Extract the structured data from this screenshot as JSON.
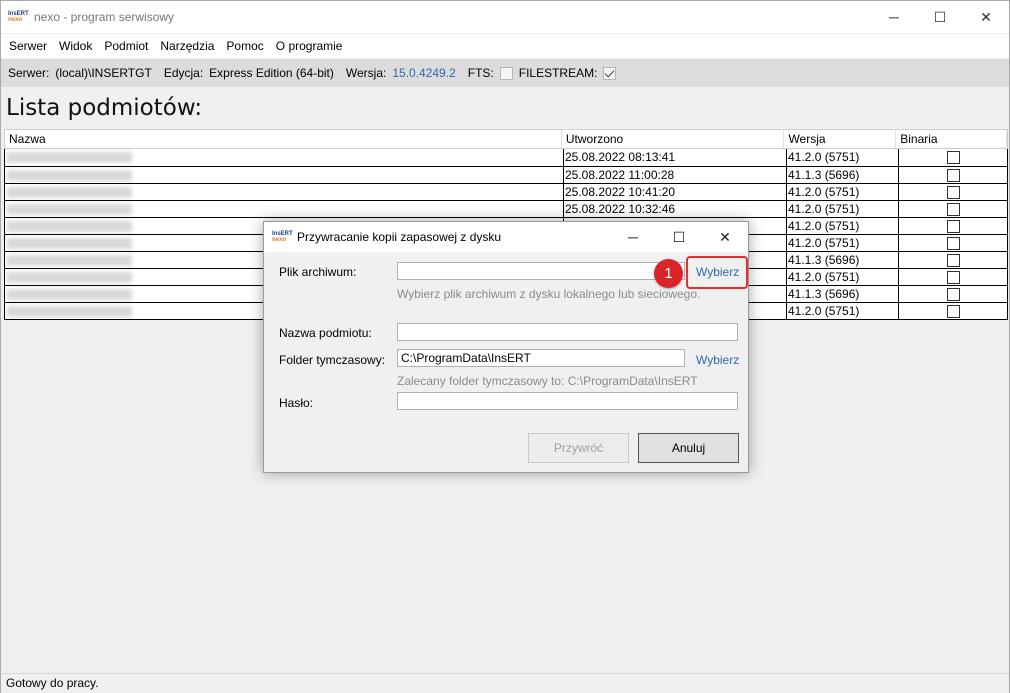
{
  "window": {
    "logo_top": "InsERT",
    "logo_bottom": "nexo",
    "title": "nexo - program serwisowy",
    "minimize": "─",
    "maximize": "☐",
    "close": "✕"
  },
  "menu": [
    "Serwer",
    "Widok",
    "Podmiot",
    "Narzędzia",
    "Pomoc",
    "O programie"
  ],
  "info": {
    "server_label": "Serwer:",
    "server_value": "(local)\\INSERTGT",
    "edition_label": "Edycja:",
    "edition_value": "Express Edition (64-bit)",
    "version_label": "Wersja:",
    "version_value": "15.0.4249.2",
    "fts_label": "FTS:",
    "filestream_label": "FILESTREAM:",
    "fts_checked": false,
    "filestream_checked": true,
    "version_color": "#2a6ab0"
  },
  "heading": "Lista podmiotów:",
  "table": {
    "columns": [
      "Nazwa",
      "Utworzono",
      "Wersja",
      "Binaria"
    ],
    "rows": [
      {
        "date": "25.08.2022 08:13:41",
        "version": "41.2.0 (5751)"
      },
      {
        "date": "25.08.2022 11:00:28",
        "version": "41.1.3 (5696)"
      },
      {
        "date": "25.08.2022 10:41:20",
        "version": "41.2.0 (5751)"
      },
      {
        "date": "25.08.2022 10:32:46",
        "version": "41.2.0 (5751)"
      },
      {
        "date": "",
        "version": "41.2.0 (5751)"
      },
      {
        "date": "",
        "version": "41.2.0 (5751)"
      },
      {
        "date": "",
        "version": "41.1.3 (5696)"
      },
      {
        "date": "",
        "version": "41.2.0 (5751)"
      },
      {
        "date": "",
        "version": "41.1.3 (5696)"
      },
      {
        "date": "",
        "version": "41.2.0 (5751)"
      }
    ]
  },
  "dialog": {
    "title": "Przywracanie kopii zapasowej z dysku",
    "archive_label": "Plik archiwum:",
    "archive_value": "",
    "archive_browse": "Wybierz",
    "archive_hint": "Wybierz plik archiwum z dysku lokalnego lub sieciowego.",
    "name_label": "Nazwa podmiotu:",
    "name_value": "",
    "temp_label": "Folder tymczasowy:",
    "temp_value": "C:\\ProgramData\\InsERT",
    "temp_browse": "Wybierz",
    "temp_hint": "Zalecany folder tymczasowy to: C:\\ProgramData\\InsERT",
    "password_label": "Hasło:",
    "password_value": "",
    "restore_button": "Przywróć",
    "cancel_button": "Anuluj",
    "step_badge": "1",
    "highlight_color": "#e03030"
  },
  "status": "Gotowy do pracy."
}
